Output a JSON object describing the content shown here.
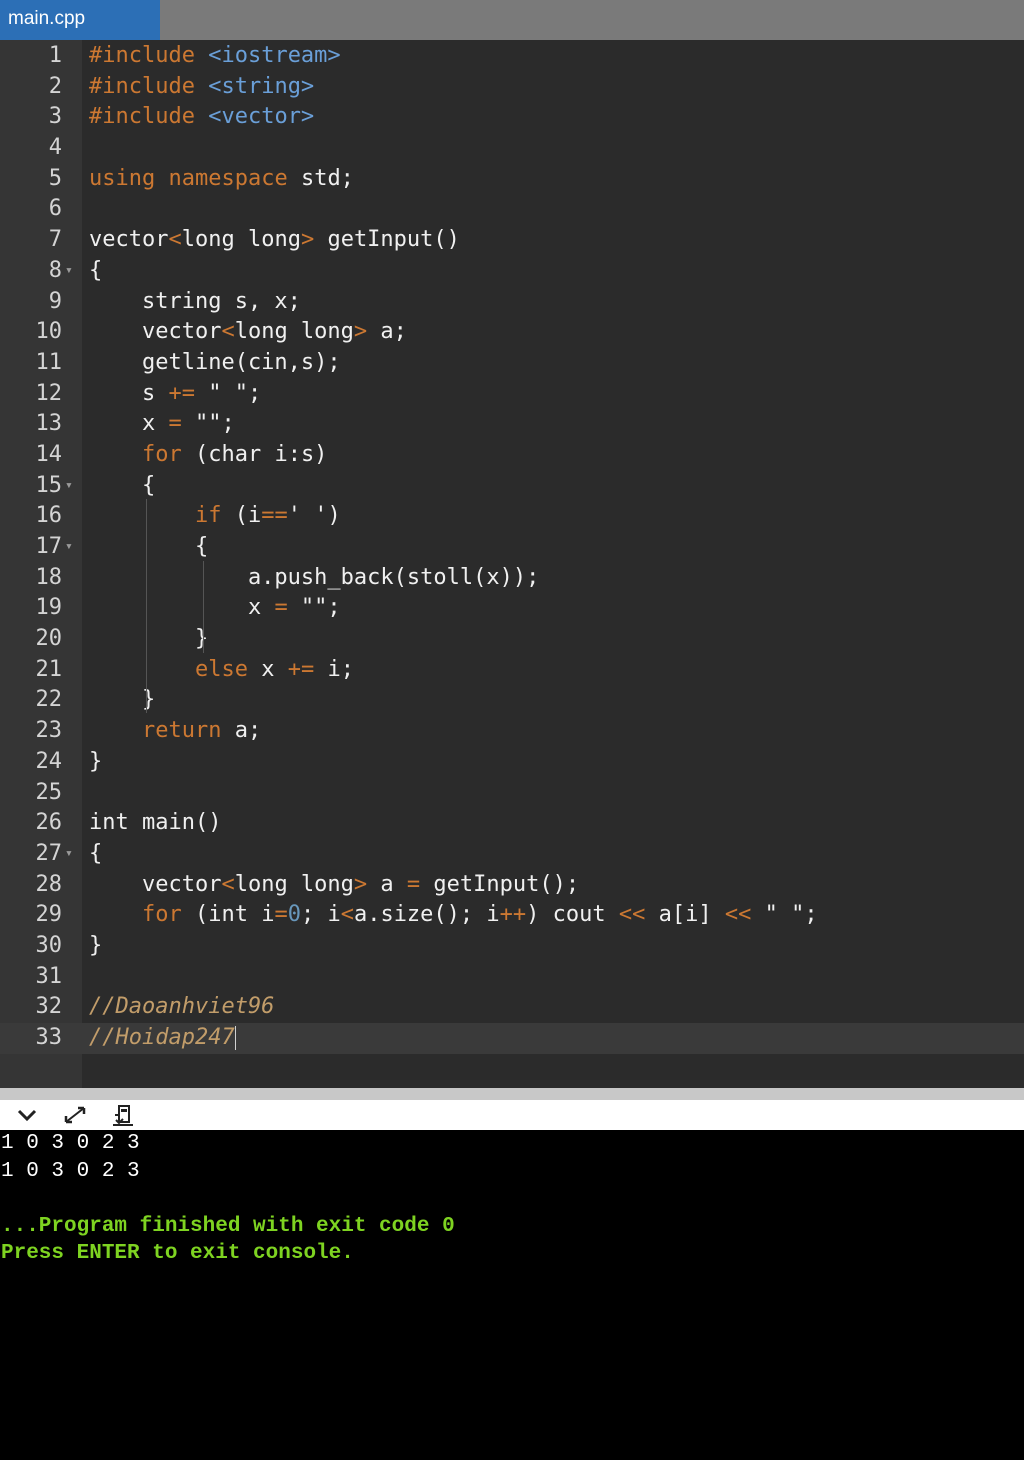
{
  "tab": {
    "label": "main.cpp"
  },
  "editor": {
    "lines": [
      {
        "n": "1",
        "html": "<span class=\"pp\">#include</span> <span class=\"inc\">&lt;iostream&gt;</span>"
      },
      {
        "n": "2",
        "html": "<span class=\"pp\">#include</span> <span class=\"inc\">&lt;string&gt;</span>"
      },
      {
        "n": "3",
        "html": "<span class=\"pp\">#include</span> <span class=\"inc\">&lt;vector&gt;</span>"
      },
      {
        "n": "4",
        "html": ""
      },
      {
        "n": "5",
        "html": "<span class=\"kw\">using</span> <span class=\"kw\">namespace</span> std;"
      },
      {
        "n": "6",
        "html": ""
      },
      {
        "n": "7",
        "html": "vector<span class=\"op\">&lt;</span>long long<span class=\"op\">&gt;</span> getInput()"
      },
      {
        "n": "8",
        "fold": true,
        "html": "{"
      },
      {
        "n": "9",
        "html": "    string s, x;"
      },
      {
        "n": "10",
        "html": "    vector<span class=\"op\">&lt;</span>long long<span class=\"op\">&gt;</span> a;"
      },
      {
        "n": "11",
        "html": "    getline(cin,s);"
      },
      {
        "n": "12",
        "html": "    s <span class=\"op\">+=</span> \" \";"
      },
      {
        "n": "13",
        "html": "    x <span class=\"op\">=</span> \"\";"
      },
      {
        "n": "14",
        "html": "    <span class=\"kw\">for</span> (char i:s)"
      },
      {
        "n": "15",
        "fold": true,
        "html": "    {"
      },
      {
        "n": "16",
        "html": "        <span class=\"kw\">if</span> (i<span class=\"op\">==</span>' ')"
      },
      {
        "n": "17",
        "fold": true,
        "html": "        {"
      },
      {
        "n": "18",
        "html": "            a.push_back(stoll(x));"
      },
      {
        "n": "19",
        "html": "            x <span class=\"op\">=</span> \"\";"
      },
      {
        "n": "20",
        "html": "        }"
      },
      {
        "n": "21",
        "html": "        <span class=\"kw\">else</span> x <span class=\"op\">+=</span> i;"
      },
      {
        "n": "22",
        "html": "    }"
      },
      {
        "n": "23",
        "html": "    <span class=\"kw\">return</span> a;"
      },
      {
        "n": "24",
        "html": "}"
      },
      {
        "n": "25",
        "html": ""
      },
      {
        "n": "26",
        "html": "int main()"
      },
      {
        "n": "27",
        "fold": true,
        "html": "{"
      },
      {
        "n": "28",
        "html": "    vector<span class=\"op\">&lt;</span>long long<span class=\"op\">&gt;</span> a <span class=\"op\">=</span> getInput();"
      },
      {
        "n": "29",
        "html": "    <span class=\"kw\">for</span> (int i<span class=\"op\">=</span><span class=\"num\">0</span>; i<span class=\"op\">&lt;</span>a.size(); i<span class=\"op\">++</span>) cout <span class=\"op\">&lt;&lt;</span> a[i] <span class=\"op\">&lt;&lt;</span> \" \";"
      },
      {
        "n": "30",
        "html": "}"
      },
      {
        "n": "31",
        "html": ""
      },
      {
        "n": "32",
        "html": "<span class=\"cm\">//Daoanhviet96</span>"
      },
      {
        "n": "33",
        "active": true,
        "html": "<span class=\"cm\">//Hoidap247</span><span class=\"caret\"></span>"
      }
    ]
  },
  "console": {
    "lines": [
      {
        "text": "1 0 3 0 2 3",
        "kind": "out"
      },
      {
        "text": "1 0 3 0 2 3",
        "kind": "out"
      },
      {
        "text": "",
        "kind": "out"
      },
      {
        "text": "...Program finished with exit code 0",
        "kind": "fin"
      },
      {
        "text": "Press ENTER to exit console.",
        "kind": "fin"
      }
    ],
    "buttons": [
      "chevron-down-icon",
      "expand-icon",
      "clear-console-icon"
    ]
  }
}
